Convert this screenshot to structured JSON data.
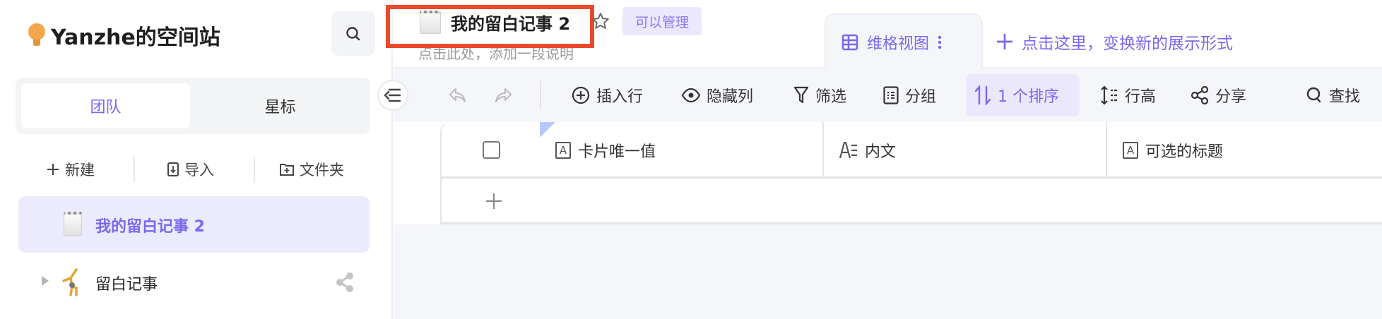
{
  "sidebar": {
    "workspace_title": "Yanzhe的空间站",
    "tabs": [
      {
        "label": "团队",
        "active": true
      },
      {
        "label": "星标",
        "active": false
      }
    ],
    "actions": [
      {
        "label": "新建",
        "icon": "plus-icon"
      },
      {
        "label": "导入",
        "icon": "import-icon"
      },
      {
        "label": "文件夹",
        "icon": "folder-add-icon"
      }
    ],
    "items": [
      {
        "label": "我的留白记事 2",
        "icon": "notepad-icon",
        "selected": true
      },
      {
        "label": "留白记事",
        "icon": "gymnast-icon",
        "selected": false
      }
    ]
  },
  "header": {
    "title": "我的留白记事 2",
    "permission_badge": "可以管理",
    "description_placeholder": "点击此处，添加一段说明",
    "view_tab": "维格视图",
    "add_view": "点击这里，变换新的展示形式"
  },
  "toolbar": {
    "insert_row": "插入行",
    "hide_columns": "隐藏列",
    "filter": "筛选",
    "group": "分组",
    "sort": "1 个排序",
    "row_height": "行高",
    "share": "分享",
    "find": "查找"
  },
  "table": {
    "columns": [
      {
        "label": "卡片唯一值",
        "icon": "text-field-icon"
      },
      {
        "label": "内文",
        "icon": "long-text-field-icon"
      },
      {
        "label": "可选的标题",
        "icon": "text-field-icon"
      }
    ]
  },
  "colors": {
    "accent": "#7b67ee",
    "highlight": "#ea4a2c",
    "selected_bg": "#ecebfd"
  }
}
